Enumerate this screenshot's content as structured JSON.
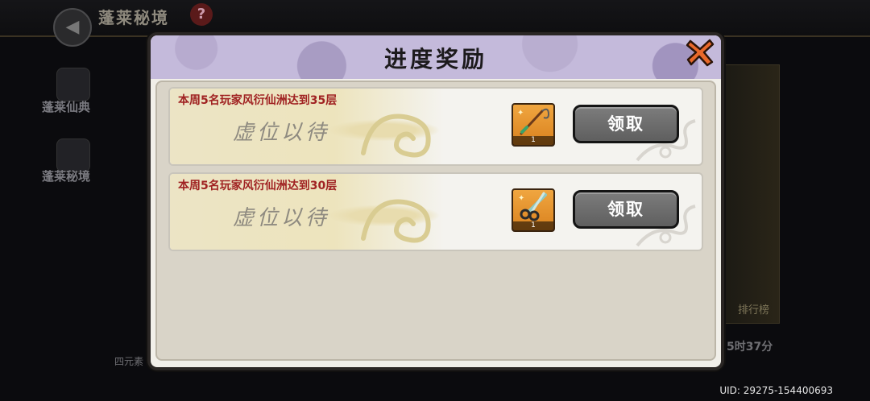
{
  "background": {
    "title": "蓬莱秘境",
    "help_label": "?",
    "side_items": [
      "蓬莱仙典",
      "蓬莱秘境"
    ],
    "rank_label": "排行榜",
    "timer_text": "5时37分",
    "bottom_left_label": "四元素"
  },
  "modal": {
    "title": "进度奖励",
    "close_icon": "close-x-icon",
    "rewards": [
      {
        "caption": "本周5名玩家风衍仙洲达到35层",
        "placeholder": "虚位以待",
        "item_icon": "fishing-rod-icon",
        "item_count": "1",
        "claim_label": "领取"
      },
      {
        "caption": "本周5名玩家风衍仙洲达到30层",
        "placeholder": "虚位以待",
        "item_icon": "scissors-icon",
        "item_count": "1",
        "claim_label": "领取"
      }
    ]
  },
  "uid_text": "UID: 29275-154400693",
  "colors": {
    "caption_red": "#a02222",
    "header_purple": "#c4badb",
    "item_orange": "#e8952e",
    "button_gray": "#6e6e6e",
    "close_orange": "#e8692a"
  }
}
